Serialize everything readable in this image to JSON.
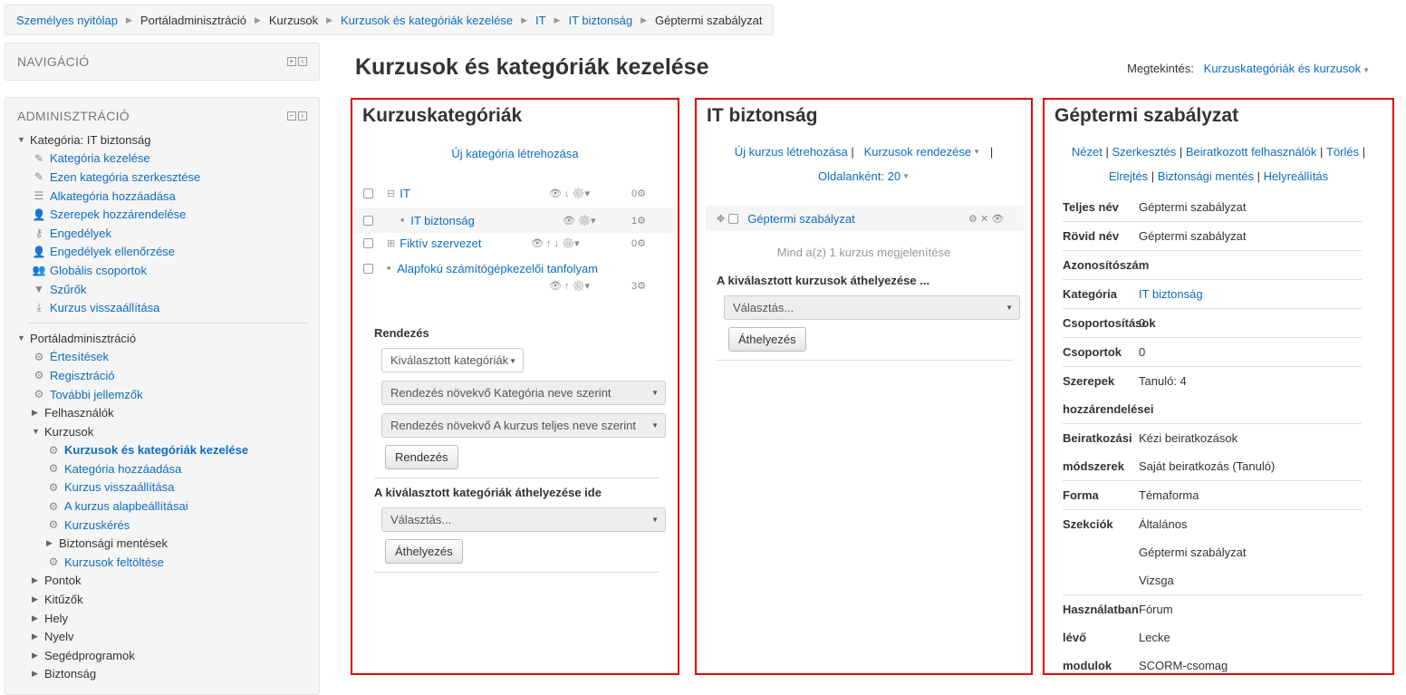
{
  "breadcrumb": [
    "Személyes nyitólap",
    "Portáladminisztráció",
    "Kurzusok",
    "Kurzusok és kategóriák kezelése",
    "IT",
    "IT biztonság",
    "Géptermi szabályzat"
  ],
  "nav_block": {
    "title": "NAVIGÁCIÓ"
  },
  "admin_block": {
    "title": "ADMINISZTRÁCIÓ",
    "category_title": "Kategória: IT biztonság",
    "category_items": [
      {
        "icon": "pencil-icon",
        "label": "Kategória kezelése"
      },
      {
        "icon": "pencil-icon",
        "label": "Ezen kategória szerkesztése"
      },
      {
        "icon": "list-add-icon",
        "label": "Alkategória hozzáadása"
      },
      {
        "icon": "user-assign-icon",
        "label": "Szerepek hozzárendelése"
      },
      {
        "icon": "key-icon",
        "label": "Engedélyek"
      },
      {
        "icon": "user-check-icon",
        "label": "Engedélyek ellenőrzése"
      },
      {
        "icon": "users-icon",
        "label": "Globális csoportok"
      },
      {
        "icon": "filter-icon",
        "label": "Szűrők"
      },
      {
        "icon": "restore-icon",
        "label": "Kurzus visszaállítása"
      }
    ],
    "site_title": "Portáladminisztráció",
    "site_items": [
      {
        "label": "Értesítések"
      },
      {
        "label": "Regisztráció"
      },
      {
        "label": "További jellemzők"
      }
    ],
    "users_label": "Felhasználók",
    "courses_label": "Kurzusok",
    "courses_items": [
      {
        "label": "Kurzusok és kategóriák kezelése",
        "active": true
      },
      {
        "label": "Kategória hozzáadása"
      },
      {
        "label": "Kurzus visszaállítása"
      },
      {
        "label": "A kurzus alapbeállításai"
      },
      {
        "label": "Kurzuskérés"
      }
    ],
    "backups_label": "Biztonsági mentések",
    "upload_label": "Kurzusok feltöltése",
    "more": [
      "Pontok",
      "Kitűzők",
      "Hely",
      "Nyelv",
      "Segédprogramok",
      "Biztonság"
    ]
  },
  "page_title": "Kurzusok és kategóriák kezelése",
  "viewing": {
    "label": "Megtekintés:",
    "value": "Kurzuskategóriák és kurzusok"
  },
  "categories_panel": {
    "title": "Kurzuskategóriák",
    "create_link": "Új kategória létrehozása",
    "items": [
      {
        "name": "IT",
        "count": "0"
      },
      {
        "name": "IT biztonság",
        "count": "1"
      },
      {
        "name": "Fiktív szervezet",
        "count": "0"
      },
      {
        "name": "Alapfokú számítógépkezelői tanfolyam",
        "count": "3"
      }
    ],
    "sort_heading": "Rendezés",
    "sort_select": "Kiválasztott kategóriák",
    "sort_option1": "Rendezés növekvő Kategória neve szerint",
    "sort_option2": "Rendezés növekvő A kurzus teljes neve szerint",
    "sort_button": "Rendezés",
    "move_heading": "A kiválasztott kategóriák áthelyezése ide",
    "move_select": "Választás...",
    "move_button": "Áthelyezés"
  },
  "courses_panel": {
    "title": "IT biztonság",
    "create_link": "Új kurzus létrehozása",
    "sort_link": "Kurzusok rendezése",
    "per_page": "Oldalanként: 20",
    "course": "Géptermi szabályzat",
    "summary": "Mind a(z) 1 kurzus megjelenítése",
    "move_heading": "A kiválasztott kurzusok áthelyezése ...",
    "move_select": "Választás...",
    "move_button": "Áthelyezés"
  },
  "detail_panel": {
    "title": "Géptermi szabályzat",
    "actions": [
      "Nézet",
      "Szerkesztés",
      "Beiratkozott felhasználók",
      "Törlés",
      "Elrejtés",
      "Biztonsági mentés",
      "Helyreállítás"
    ],
    "fullname_label": "Teljes név",
    "fullname": "Géptermi szabályzat",
    "shortname_label": "Rövid név",
    "shortname": "Géptermi szabályzat",
    "id_label": "Azonosítószám",
    "category_label": "Kategória",
    "category": "IT biztonság",
    "groupings_label": "Csoportosítások",
    "groupings": "0",
    "groups_label": "Csoportok",
    "groups": "0",
    "roles_label1": "Szerepek",
    "roles_label2": "hozzárendelései",
    "roles": "Tanuló: 4",
    "enrol_label1": "Beiratkozási",
    "enrol_label2": "módszerek",
    "enrol1": "Kézi beiratkozások",
    "enrol2": "Saját beiratkozás (Tanuló)",
    "format_label": "Forma",
    "format": "Témaforma",
    "sections_label": "Szekciók",
    "sections": [
      "Általános",
      "Géptermi szabályzat",
      "Vizsga"
    ],
    "modules_label1": "Használatban",
    "modules_label2": "lévő",
    "modules_label3": "modulok",
    "modules": [
      "Fórum",
      "Lecke",
      "SCORM-csomag"
    ]
  }
}
